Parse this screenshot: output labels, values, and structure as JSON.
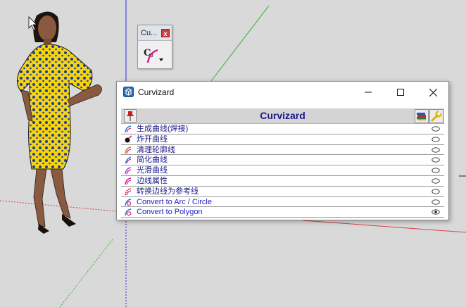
{
  "mini_toolbar": {
    "title": "Cu...",
    "close_label": "x"
  },
  "window": {
    "title": "Curvizard",
    "header_title": "Curvizard"
  },
  "items": [
    {
      "label": "生成曲线(焊接)",
      "color": "#1a1a8a",
      "visible": false
    },
    {
      "label": "炸开曲线",
      "color": "#1a1a8a",
      "visible": false
    },
    {
      "label": "清理轮廓线",
      "color": "#1a1a8a",
      "visible": false
    },
    {
      "label": "简化曲线",
      "color": "#1a1a8a",
      "visible": false
    },
    {
      "label": "光滑曲线",
      "color": "#1a1a8a",
      "visible": false
    },
    {
      "label": "边线属性",
      "color": "#1a1a8a",
      "visible": false
    },
    {
      "label": "转换边线为参考线",
      "color": "#1a1a8a",
      "visible": false
    },
    {
      "label": "Convert to Arc / Circle",
      "color": "#2323c8",
      "visible": false
    },
    {
      "label": "Convert to Polygon",
      "color": "#2323c8",
      "visible": true
    }
  ]
}
